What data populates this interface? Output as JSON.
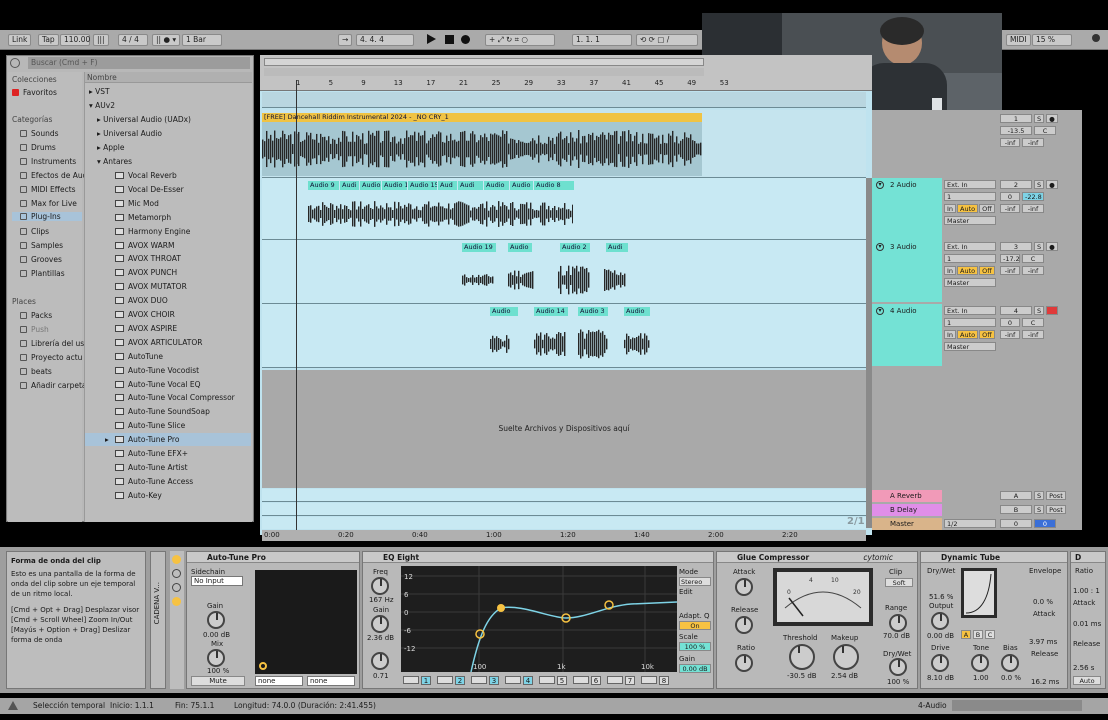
{
  "toolbar": {
    "link": "Link",
    "tap": "Tap",
    "tempo": "110.00",
    "signature": "4 / 4",
    "quantize": "1 Bar",
    "position": "4.    4.    4",
    "loop_start": "1.    1.    1",
    "midi": "MIDI",
    "cpu": "15 %",
    "key_h": "H",
    "key_w": "W"
  },
  "browser": {
    "search_placeholder": "Buscar (Cmd + F)",
    "collections_header": "Colecciones",
    "favorites": "Favoritos",
    "categories_header": "Categorías",
    "categories": [
      "Sounds",
      "Drums",
      "Instruments",
      "Efectos de Aud",
      "MIDI Effects",
      "Max for Live",
      "Plug-Ins",
      "Clips",
      "Samples",
      "Grooves",
      "Plantillas"
    ],
    "places_header": "Places",
    "places": [
      "Packs",
      "Push",
      "Librería del usu",
      "Proyecto actu",
      "beats",
      "Añadir carpeta..."
    ],
    "name_header": "Nombre",
    "tree": [
      "VST",
      "AUv2",
      "Universal Audio (UADx)",
      "Universal Audio",
      "Apple",
      "Antares"
    ],
    "plugins": [
      "Vocal Reverb",
      "Vocal De-Esser",
      "Mic Mod",
      "Metamorph",
      "Harmony Engine",
      "AVOX WARM",
      "AVOX THROAT",
      "AVOX PUNCH",
      "AVOX MUTATOR",
      "AVOX DUO",
      "AVOX CHOIR",
      "AVOX ASPIRE",
      "AVOX ARTICULATOR",
      "AutoTune",
      "Auto-Tune Vocodist",
      "Auto-Tune Vocal EQ",
      "Auto-Tune Vocal Compressor",
      "Auto-Tune SoundSoap",
      "Auto-Tune Slice",
      "Auto-Tune Pro",
      "Auto-Tune EFX+",
      "Auto-Tune Artist",
      "Auto-Tune Access",
      "Auto-Key"
    ],
    "selected_plugin": "Auto-Tune Pro"
  },
  "ruler": {
    "bars": [
      "1",
      "5",
      "9",
      "13",
      "17",
      "21",
      "25",
      "29",
      "33",
      "37",
      "41",
      "45",
      "49",
      "53"
    ],
    "times": [
      "0:00",
      "0:20",
      "0:40",
      "1:00",
      "1:20",
      "1:40",
      "2:00",
      "2:20"
    ],
    "zoom_label": "2/1"
  },
  "tracks": {
    "track1_clip": "[FREE] Dancehall Riddim Instrumental 2024 - _NO CRY_1",
    "track2_clips": [
      "Audio 9",
      "Audi",
      "Audio",
      "Audio 1",
      "Audio 15",
      "Aud",
      "Audi",
      "Audio",
      "Audio",
      "Audio 8"
    ],
    "track3_clips": [
      "Audio 19",
      "Audio",
      "Audio 2",
      "Audi"
    ],
    "track4_clips": [
      "Audio",
      "Audio 14",
      "Audio 3",
      "Audio"
    ],
    "drop_text": "Suelte Archivos y Dispositivos aquí",
    "names": [
      "2 Audio",
      "3 Audio",
      "4 Audio"
    ],
    "numbers": [
      "1",
      "2",
      "3",
      "4"
    ],
    "input_type": "Ext. In",
    "input_channel": "1",
    "monitor": [
      "In",
      "Auto",
      "Off"
    ],
    "output": "Master",
    "vol_values": [
      "-13.5",
      "0",
      "-17.2",
      "0",
      "0"
    ],
    "pan": "C",
    "pan2": "-22.8",
    "inf": "-inf",
    "returns": [
      "A Reverb",
      "B Delay",
      "Master"
    ],
    "return_letters": [
      "A",
      "B"
    ],
    "post": "Post",
    "master_out": "1/2",
    "solo": "S"
  },
  "devices": {
    "help_title": "Forma de onda del clip",
    "help_body": "Esto es una pantalla de la forma de onda del clip sobre un eje temporal de un ritmo local.",
    "help_keys": "[Cmd + Opt + Drag] Desplazar visor\n[Cmd + Scroll Wheel] Zoom In/Out\n[Mayús + Option + Drag] Deslizar forma de onda",
    "chain_label": "CADENA V...",
    "autotune": {
      "title": "Auto-Tune Pro",
      "sidechain": "Sidechain",
      "input": "No Input",
      "gain": "Gain",
      "gain_val": "0.00 dB",
      "mix": "Mix",
      "mix_val": "100 %",
      "mute": "Mute",
      "none": "none"
    },
    "eq": {
      "title": "EQ Eight",
      "freq": "Freq",
      "freq_val": "167 Hz",
      "gain": "Gain",
      "gain_val": "2.36 dB",
      "q_val": "0.71",
      "db_labels": [
        "12",
        "6",
        "0",
        "-6",
        "-12"
      ],
      "hz_labels": [
        "100",
        "1k",
        "10k"
      ],
      "mode": "Mode",
      "mode_val": "Stereo",
      "edit": "Edit",
      "adapt": "Adapt. Q",
      "on": "On",
      "scale": "Scale",
      "scale_val": "100 %",
      "out_gain": "Gain",
      "out_gain_val": "0.00 dB",
      "bands": [
        "1",
        "2",
        "3",
        "4",
        "5",
        "6",
        "7",
        "8"
      ]
    },
    "glue": {
      "title": "Glue Compressor",
      "brand": "cytomic",
      "attack": "Attack",
      "release": "Release",
      "ratio": "Ratio",
      "clip": "Clip",
      "soft": "Soft",
      "range": "Range",
      "range_val": "70.0 dB",
      "threshold": "Threshold",
      "threshold_val": "-30.5 dB",
      "makeup": "Makeup",
      "makeup_val": "2.54 dB",
      "drywet": "Dry/Wet",
      "drywet_val": "100 %",
      "meter_labels": [
        "0",
        "4",
        "10",
        "20"
      ]
    },
    "tube": {
      "title": "Dynamic Tube",
      "drywet": "Dry/Wet",
      "drywet_val": "51.6 %",
      "output": "Output",
      "output_val": "0.00 dB",
      "drive": "Drive",
      "drive_val": "8.10 dB",
      "tone": "Tone",
      "tone_val": "1.00",
      "bias": "Bias",
      "bias_val": "0.0 %",
      "envelope": "Envelope",
      "envelope_val": "0.0 %",
      "attack": "Attack",
      "attack_val": "3.97 ms",
      "release": "Release",
      "release_val": "16.2 ms",
      "abc": [
        "A",
        "B",
        "C"
      ]
    },
    "next": {
      "ratio": "Ratio",
      "ratio_val": "1.00 : 1",
      "attack": "Attack",
      "attack_val": "0.01 ms",
      "release": "Release",
      "release_val": "2.56 s",
      "auto": "Auto"
    }
  },
  "status": {
    "selection": "Selección temporal",
    "start": "Inicio: 1.1.1",
    "end": "Fin: 75.1.1",
    "length": "Longitud: 74.0.0 (Duración: 2:41.455)",
    "track": "4-Audio"
  }
}
